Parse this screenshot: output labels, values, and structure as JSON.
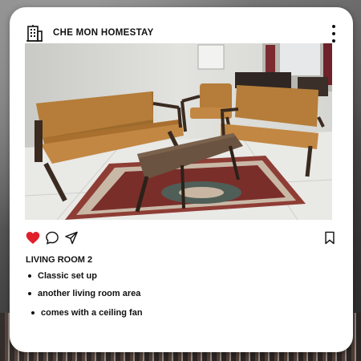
{
  "post": {
    "account_name": "CHE MON HOMESTAY",
    "logo_icon": "building-icon",
    "menu_icon": "more-vertical-icon",
    "image_alt": "Living room with tan leather sofa set, wooden coffee table and patterned rug",
    "actions": [
      {
        "icon": "heart-icon",
        "state": "liked",
        "color": "#e0202a"
      },
      {
        "icon": "comment-icon"
      },
      {
        "icon": "share-icon"
      },
      {
        "icon": "bookmark-icon"
      }
    ],
    "caption_title": "LIVING ROOM 2",
    "caption_items": [
      "Classic set up",
      "another living room area",
      "comes with a ceiling fan"
    ]
  },
  "colors": {
    "card": "#ffffff",
    "text": "#111111",
    "like": "#e0202a",
    "sofa": "#b07a34"
  }
}
